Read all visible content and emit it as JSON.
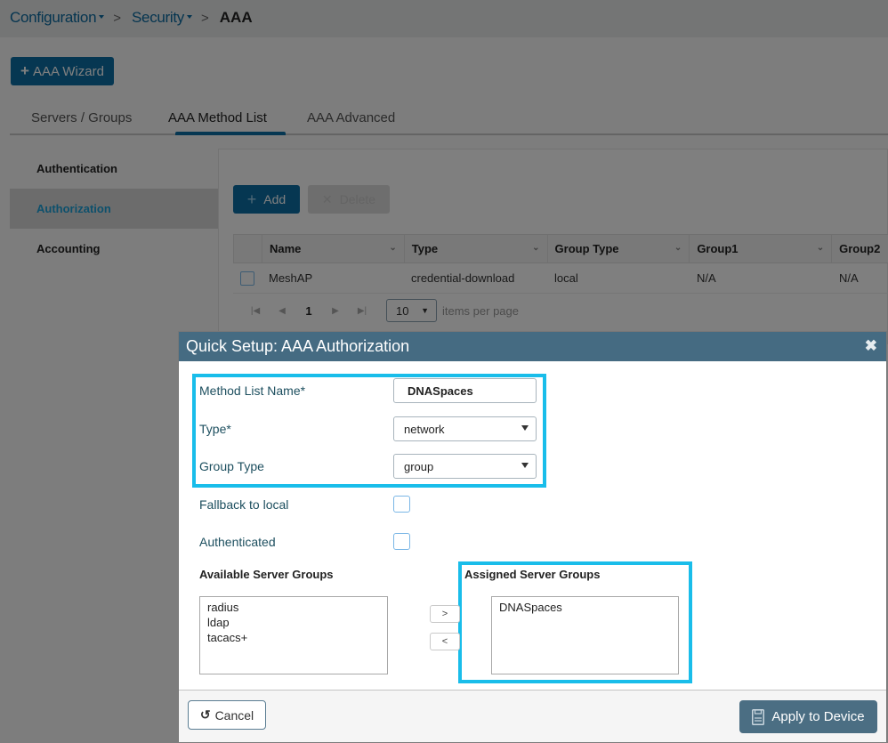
{
  "breadcrumb": {
    "items": [
      "Configuration",
      "Security"
    ],
    "current": "AAA"
  },
  "toolbar": {
    "wizard_label": "AAA Wizard"
  },
  "tabs": [
    {
      "label": "Servers / Groups",
      "active": false
    },
    {
      "label": "AAA Method List",
      "active": true
    },
    {
      "label": "AAA Advanced",
      "active": false
    }
  ],
  "sidebar": {
    "items": [
      {
        "label": "Authentication",
        "active": false
      },
      {
        "label": "Authorization",
        "active": true
      },
      {
        "label": "Accounting",
        "active": false
      }
    ]
  },
  "list_actions": {
    "add_label": "Add",
    "delete_label": "Delete"
  },
  "table": {
    "columns": [
      "Name",
      "Type",
      "Group Type",
      "Group1",
      "Group2"
    ],
    "rows": [
      {
        "name": "MeshAP",
        "type": "credential-download",
        "group_type": "local",
        "group1": "N/A",
        "group2": "N/A"
      }
    ],
    "pagination": {
      "current_page": "1",
      "per_page": "10",
      "per_page_label": "items per page"
    }
  },
  "modal": {
    "title": "Quick Setup: AAA Authorization",
    "method_list_name_label": "Method List Name*",
    "method_list_name_value": "DNASpaces",
    "type_label": "Type*",
    "type_value": "network",
    "group_type_label": "Group Type",
    "group_type_value": "group",
    "fallback_label": "Fallback to local",
    "fallback_checked": false,
    "authenticated_label": "Authenticated",
    "authenticated_checked": false,
    "available_title": "Available Server Groups",
    "available_items": [
      "radius",
      "ldap",
      "tacacs+"
    ],
    "assigned_title": "Assigned Server Groups",
    "assigned_items": [
      "DNASpaces"
    ],
    "move_right_label": ">",
    "move_left_label": "<",
    "cancel_label": "Cancel",
    "apply_label": "Apply to Device",
    "highlight_color": "#19bdea",
    "header_color": "#456b82"
  }
}
